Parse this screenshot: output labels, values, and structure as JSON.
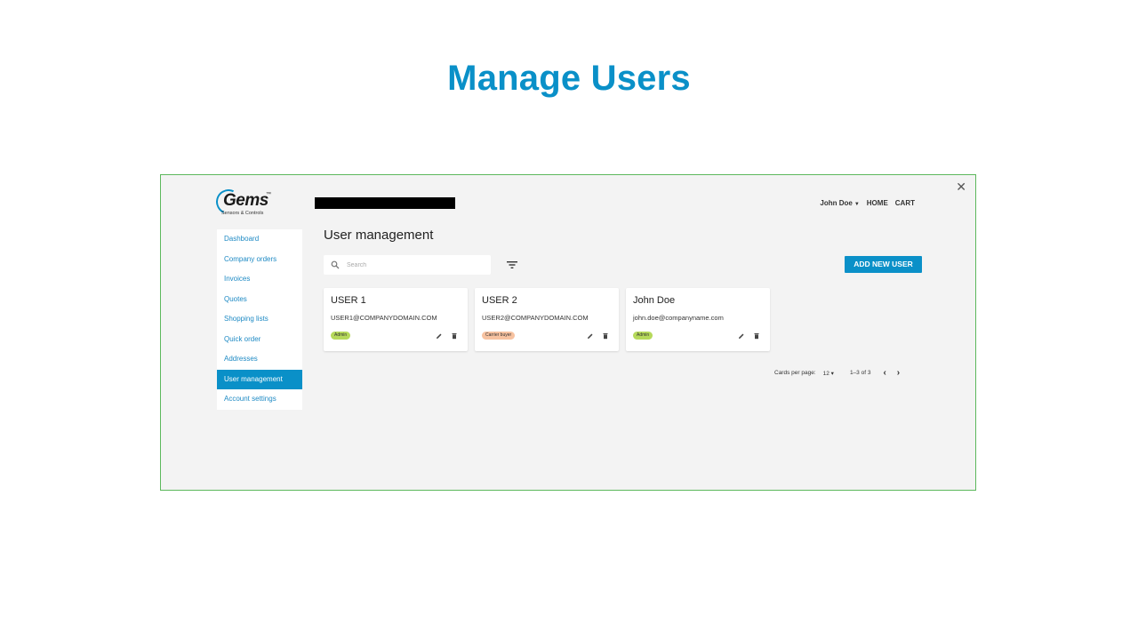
{
  "slide": {
    "title": "Manage Users"
  },
  "logo": {
    "word": "Gems",
    "tm": "™",
    "subtitle": "Sensors & Controls"
  },
  "topnav": {
    "user": "John Doe",
    "home": "HOME",
    "cart": "CART"
  },
  "sidebar": {
    "items": [
      {
        "label": "Dashboard",
        "active": false
      },
      {
        "label": "Company orders",
        "active": false
      },
      {
        "label": "Invoices",
        "active": false
      },
      {
        "label": "Quotes",
        "active": false
      },
      {
        "label": "Shopping lists",
        "active": false
      },
      {
        "label": "Quick order",
        "active": false
      },
      {
        "label": "Addresses",
        "active": false
      },
      {
        "label": "User management",
        "active": true
      },
      {
        "label": "Account settings",
        "active": false
      }
    ]
  },
  "main": {
    "heading": "User management",
    "search_placeholder": "Search",
    "add_button": "ADD NEW USER"
  },
  "cards": [
    {
      "name": "USER 1",
      "email": "USER1@COMPANYDOMAIN.COM",
      "role": "Admin"
    },
    {
      "name": "USER 2",
      "email": "USER2@COMPANYDOMAIN.COM",
      "role": "Carrier buyer"
    },
    {
      "name": "John Doe",
      "email": "john.doe@companyname.com",
      "role": "Admin"
    }
  ],
  "pagination": {
    "label": "Cards per page:",
    "per_page": "12",
    "range": "1–3 of 3",
    "prev": "‹",
    "next": "›"
  },
  "colors": {
    "accent": "#0a90c8",
    "admin_badge": "#b6d95b",
    "buyer_badge": "#f7c2a0",
    "frame_border": "#5cb85c"
  }
}
